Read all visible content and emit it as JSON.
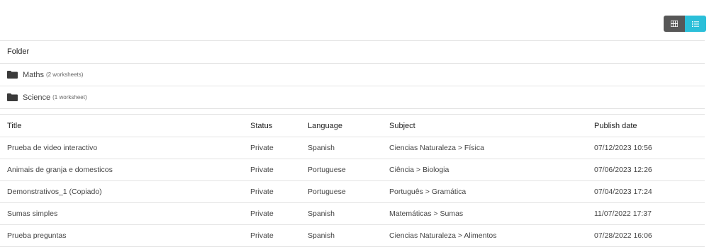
{
  "view_toggle": {
    "grid_icon": "grid-icon",
    "list_icon": "list-icon",
    "active": "list",
    "active_color": "#2bbfd9",
    "inactive_color": "#575757"
  },
  "folders": {
    "header": "Folder",
    "items": [
      {
        "name": "Maths",
        "count": "(2 worksheets)"
      },
      {
        "name": "Science",
        "count": "(1 worksheet)"
      }
    ]
  },
  "worksheets": {
    "columns": [
      "Title",
      "Status",
      "Language",
      "Subject",
      "Publish date"
    ],
    "rows": [
      {
        "title": "Prueba de video interactivo",
        "status": "Private",
        "language": "Spanish",
        "subject": "Ciencias Naturaleza > Física",
        "date": "07/12/2023 10:56"
      },
      {
        "title": "Animais de granja e domesticos",
        "status": "Private",
        "language": "Portuguese",
        "subject": "Ciência > Biologia",
        "date": "07/06/2023 12:26"
      },
      {
        "title": "Demonstrativos_1 (Copiado)",
        "status": "Private",
        "language": "Portuguese",
        "subject": "Português > Gramática",
        "date": "07/04/2023 17:24"
      },
      {
        "title": "Sumas simples",
        "status": "Private",
        "language": "Spanish",
        "subject": "Matemáticas > Sumas",
        "date": "11/07/2022 17:37"
      },
      {
        "title": "Prueba preguntas",
        "status": "Private",
        "language": "Spanish",
        "subject": "Ciencias Naturaleza > Alimentos",
        "date": "07/28/2022 16:06"
      }
    ]
  }
}
